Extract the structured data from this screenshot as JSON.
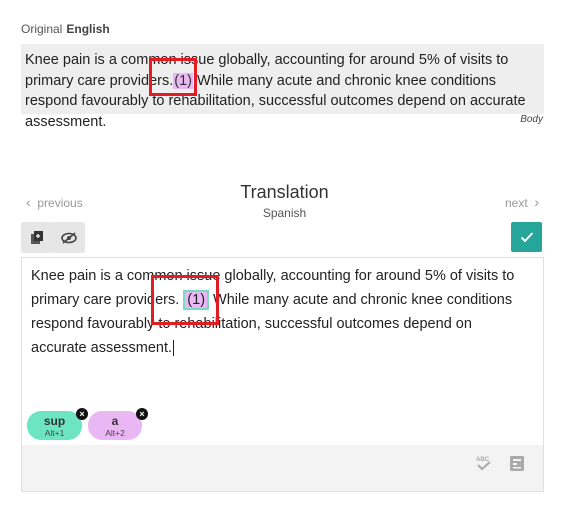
{
  "original": {
    "label": "Original",
    "language": "English",
    "text_before": "Knee pain is a common issue globally, accounting for around 5% of visits to primary care providers.",
    "citation": "(1)",
    "text_after": " While many acute and chronic knee conditions respond favourably to rehabilitation, successful outcomes depend on accurate assessment.",
    "tag": "Body"
  },
  "nav": {
    "previous": "previous",
    "next": "next"
  },
  "translation": {
    "title": "Translation",
    "language": "Spanish",
    "text_before": "Knee pain is a common issue globally, accounting for around 5% of visits to primary care providers. ",
    "citation": "(1)",
    "text_after": " While many acute and chronic knee conditions respond favourably to rehabilitation, successful outcomes depend on accurate assessment."
  },
  "tags": [
    {
      "label": "sup",
      "shortcut": "Alt+1",
      "color": "#6ee5c2"
    },
    {
      "label": "a",
      "shortcut": "Alt+2",
      "color": "#e9b7f3"
    }
  ],
  "colors": {
    "accent": "#26a69a",
    "highlight": "#e11d23"
  },
  "icons": {
    "copy_source": "copy-source-icon",
    "hide": "eye-off-icon",
    "confirm": "check-icon",
    "spellcheck": "spellcheck-icon",
    "glossary": "glossary-icon"
  }
}
